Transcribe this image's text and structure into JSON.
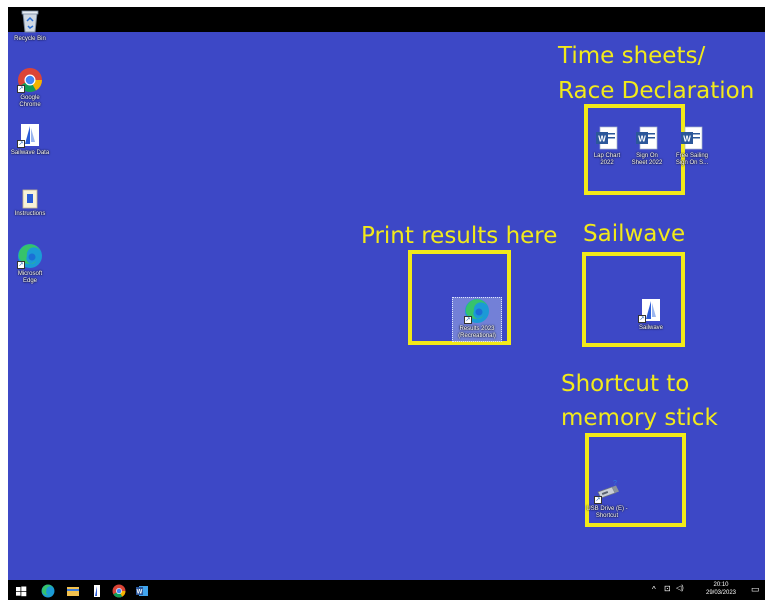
{
  "desktop_icons": {
    "recycle_bin": "Recycle Bin",
    "chrome": "Google Chrome",
    "sailwave_data": "Sailwave Data",
    "instructions": "Instructions",
    "edge": "Microsoft Edge"
  },
  "annotations": {
    "time_sheets_line1": "Time sheets/",
    "time_sheets_line2": "Race Declaration",
    "print_results": "Print results here",
    "sailwave": "Sailwave",
    "shortcut_line1": "Shortcut to",
    "shortcut_line2": "memory stick"
  },
  "files": {
    "lap_chart": "Lap Chart 2022",
    "sign_on_sheet": "Sign On Sheet 2022",
    "free_sailing": "Free Sailing Sign On S...",
    "results": "Results 2023 (Recreational)",
    "sailwave_app": "Sailwave",
    "usb_drive": "USB Drive (E) - Shortcut"
  },
  "taskbar": {
    "time": "20:10",
    "date": "29/03/2023"
  },
  "colors": {
    "desktop": "#3d48c6",
    "annotation": "#f2ea1a",
    "taskbar": "#000000"
  }
}
